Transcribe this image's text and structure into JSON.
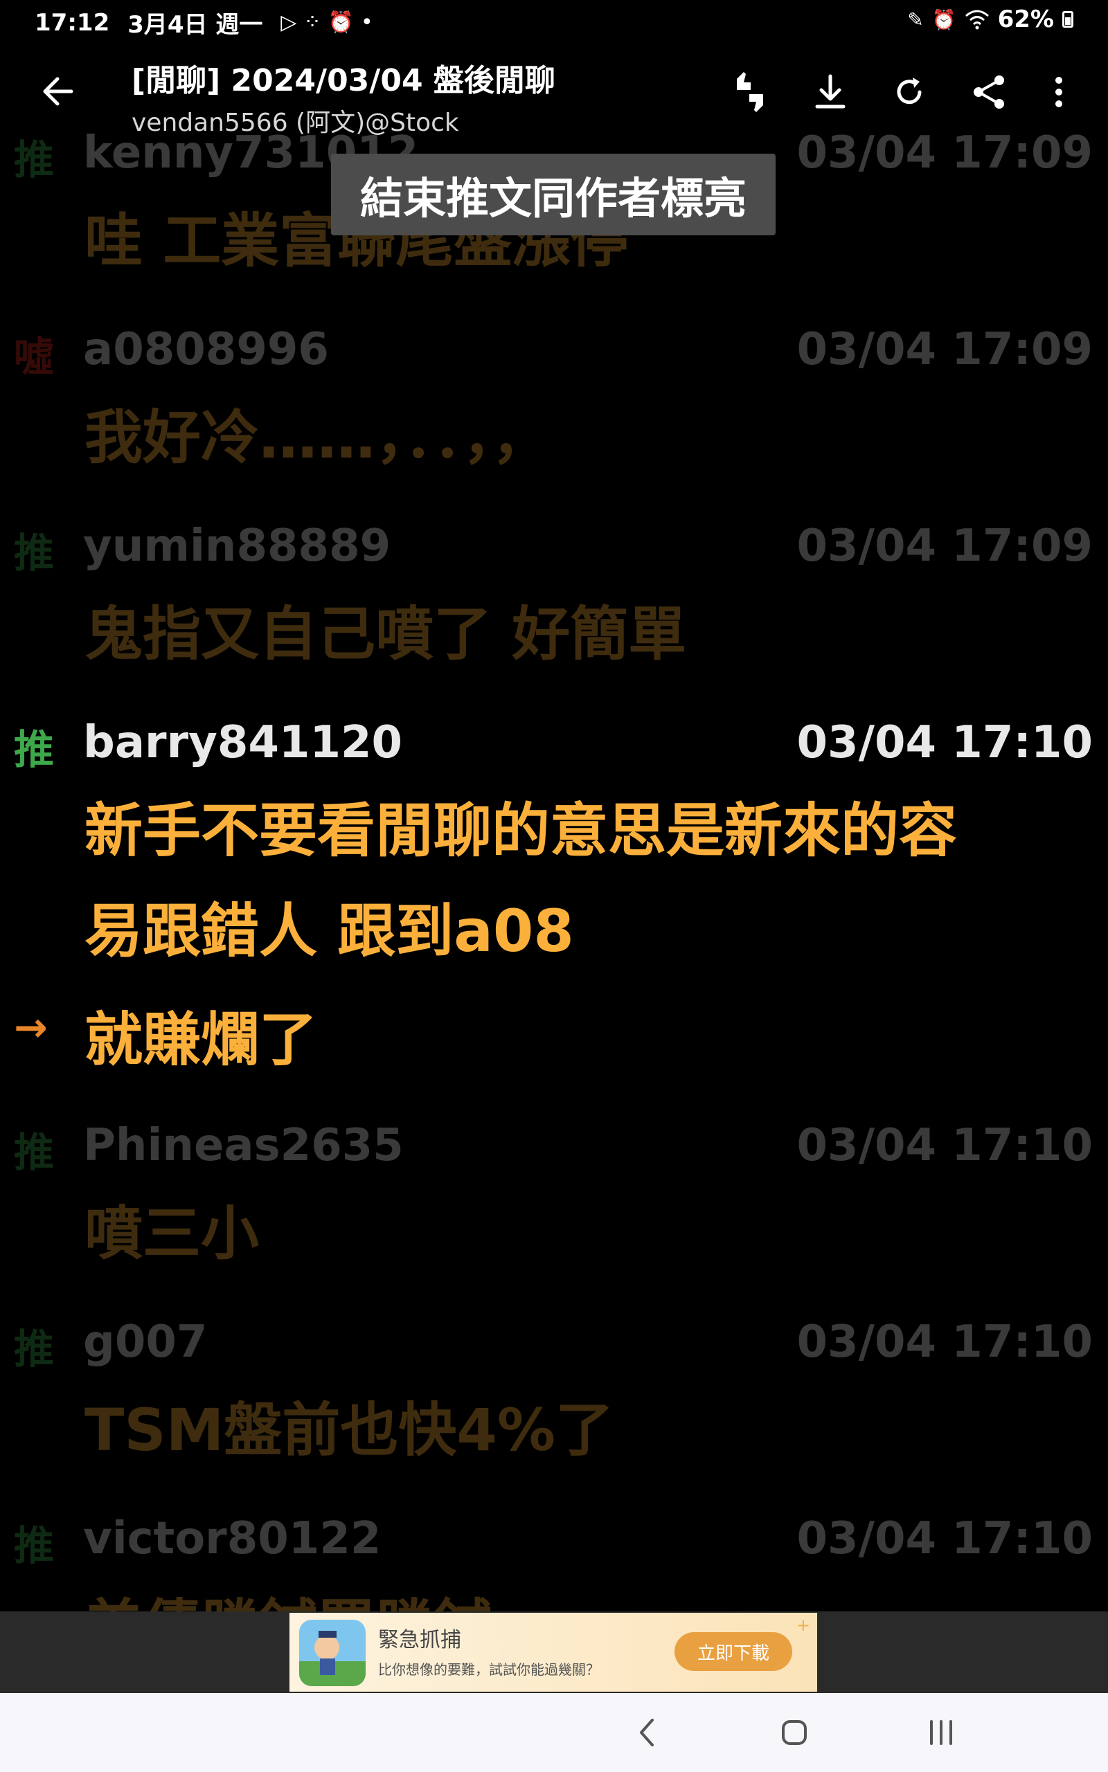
{
  "status_bar": {
    "time": "17:12",
    "date": "3月4日 週一",
    "battery": "62%",
    "icons": [
      "play-store-icon",
      "app-grid-icon",
      "alarm-icon",
      "dot-icon",
      "pen-icon",
      "alarm-icon",
      "wifi-icon",
      "battery-icon"
    ]
  },
  "header": {
    "title": "[閒聊] 2024/03/04 盤後閒聊",
    "subtitle": "vendan5566 (阿文)@Stock"
  },
  "toolbar_icons": [
    "thumbs-up-down-icon",
    "download-icon",
    "refresh-icon",
    "share-icon",
    "more-vert-icon"
  ],
  "toast": "結束推文同作者標亮",
  "comments": [
    {
      "tag": "推",
      "type": "push",
      "user": "kenny731012",
      "time": "03/04 17:09",
      "lines": [
        "哇 工業富聯尾盤漲停"
      ],
      "highlight": false
    },
    {
      "tag": "噓",
      "type": "boo",
      "user": "a0808996",
      "time": "03/04 17:09",
      "lines": [
        "我好冷……，．．，，"
      ],
      "highlight": false
    },
    {
      "tag": "推",
      "type": "push",
      "user": "yumin88889",
      "time": "03/04 17:09",
      "lines": [
        "鬼指又自己噴了 好簡單"
      ],
      "highlight": false
    },
    {
      "tag": "推",
      "type": "push",
      "user": "barry841120",
      "time": "03/04 17:10",
      "lines": [
        "新手不要看閒聊的意思是新來的容",
        "易跟錯人 跟到a08"
      ],
      "highlight": true
    },
    {
      "tag": "→",
      "type": "arrow",
      "user": "",
      "time": "",
      "lines": [
        "就賺爛了"
      ],
      "highlight": true
    },
    {
      "tag": "推",
      "type": "push",
      "user": "Phineas2635",
      "time": "03/04 17:10",
      "lines": [
        "噴三小"
      ],
      "highlight": false
    },
    {
      "tag": "推",
      "type": "push",
      "user": "g007",
      "time": "03/04 17:10",
      "lines": [
        "TSM盤前也快4%了"
      ],
      "highlight": false
    },
    {
      "tag": "推",
      "type": "push",
      "user": "victor80122",
      "time": "03/04 17:10",
      "lines": [
        "美債勝鍼罵勝鍼"
      ],
      "highlight": false
    }
  ],
  "ad": {
    "title": "緊急抓捕",
    "description": "比你想像的要難，試試你能過幾關？",
    "cta": "立即下載"
  },
  "nav_bar": [
    "back-nav-icon",
    "home-nav-icon",
    "recents-nav-icon"
  ],
  "colors": {
    "background": "#000000",
    "push_tag": "#3ea84a",
    "boo_tag": "#d2281e",
    "arrow_tag": "#e8862a",
    "comment_text": "#fbb03b",
    "toast_bg": "#4c4c4c"
  }
}
